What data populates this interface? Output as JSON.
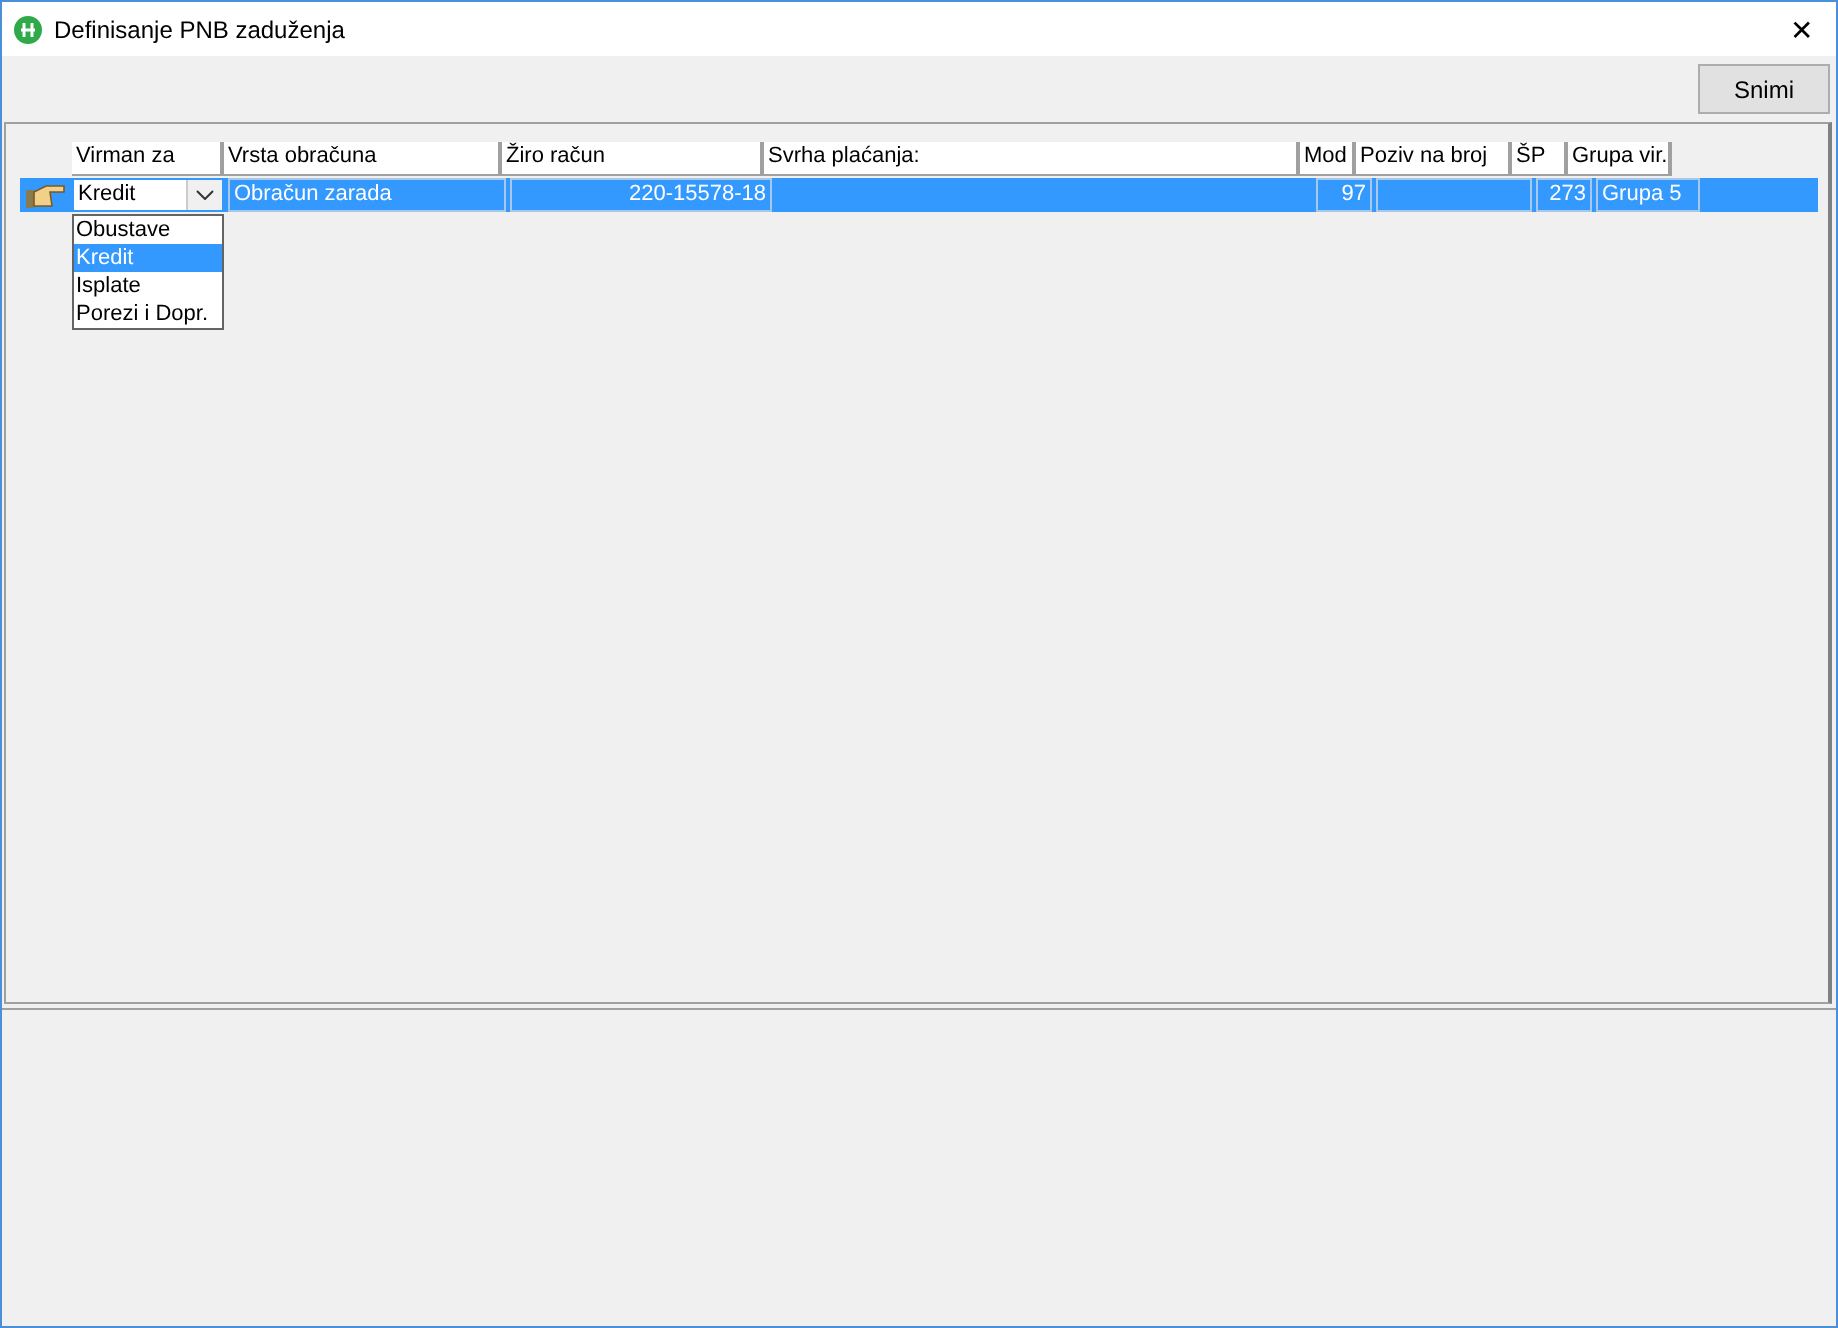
{
  "window": {
    "title": "Definisanje PNB zaduženja",
    "close": "✕"
  },
  "toolbar": {
    "buttons": [
      "Snimi"
    ]
  },
  "grid": {
    "columns": [
      {
        "label": "Virman za",
        "kind": "combo"
      },
      {
        "label": "Vrsta obračuna",
        "kind": "text"
      },
      {
        "label": "Žiro račun",
        "kind": "number"
      },
      {
        "label": "Svrha plaćanja:",
        "kind": "plain"
      },
      {
        "label": "Mod",
        "kind": "number"
      },
      {
        "label": "Poziv na broj",
        "kind": "text"
      },
      {
        "label": "ŠP",
        "kind": "number"
      },
      {
        "label": "Grupa vir.",
        "kind": "text"
      }
    ],
    "rows": [
      {
        "selected": true,
        "cells": [
          {
            "text": "Kredit"
          },
          {
            "text": "Obračun zarada"
          },
          {
            "text": "220-15578-18"
          },
          {},
          {
            "text": "97"
          },
          {},
          {
            "text": "273"
          },
          {
            "text": "Grupa 5"
          }
        ]
      }
    ]
  },
  "dropdown": {
    "open": true,
    "options": [
      {
        "label": "Obustave",
        "selected": false
      },
      {
        "label": "Kredit",
        "selected": true
      },
      {
        "label": "Isplate",
        "selected": false
      },
      {
        "label": "Porezi i Dopr.",
        "selected": false
      }
    ]
  }
}
